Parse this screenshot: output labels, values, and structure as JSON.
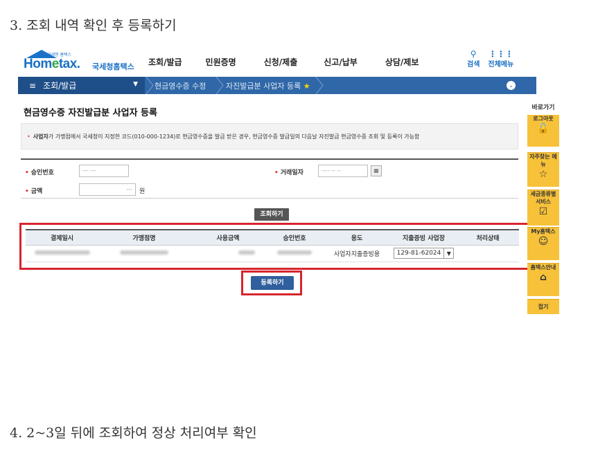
{
  "steps": {
    "step3": "3. 조회 내역 확인 후 등록하기",
    "step4": "4. 2~3일 뒤에 조회하여 정상 처리여부 확인"
  },
  "logo": {
    "small_text": "국세청 홈택스",
    "brand_ho": "Hom",
    "brand_e": "e",
    "brand_tax": "tax.",
    "sub": "국세청홈택스"
  },
  "nav": [
    "조회/발급",
    "민원증명",
    "신청/제출",
    "신고/납부",
    "상담/제보"
  ],
  "tools": {
    "search": "검색",
    "menu": "전체메뉴"
  },
  "breadcrumb": {
    "menu": "조회/발급",
    "item1": "현금영수증 수정",
    "item2": "자진발급분 사업자 등록"
  },
  "page_title": "현금영수증 자진발급분 사업자 등록",
  "notice": {
    "bold": "사업자",
    "text": "가 가맹점에서 국세청이 지정한 코드(010-000-1234)로 현금영수증을 발급 받은 경우, 현금영수증 발급일의 다음날 자진발급 현금영수증 조회 및 등록이 가능함"
  },
  "form": {
    "approval_label": "승인번호",
    "approval_value": "--- ---",
    "date_label": "거래일자",
    "date_value": "---- -- --",
    "amount_label": "금액",
    "amount_value": "---",
    "amount_unit": "원"
  },
  "buttons": {
    "search": "조회하기",
    "register": "등록하기"
  },
  "table": {
    "headers": [
      "결제일시",
      "가맹점명",
      "사용금액",
      "승인번호",
      "용도",
      "지출증빙 사업장",
      "처리상태"
    ],
    "row": {
      "purpose": "사업자지출증빙용",
      "business": "129-81-62024"
    }
  },
  "quick": {
    "head": "바로가기",
    "items": [
      "로그아웃",
      "자주찾는 메뉴",
      "세금종류별 서비스",
      "My홈택스",
      "홈택스안내",
      "접기"
    ]
  },
  "colors": {
    "accent_blue": "#2f67a8",
    "highlight_red": "#d6252e",
    "quick_yellow": "#f7c23a"
  }
}
